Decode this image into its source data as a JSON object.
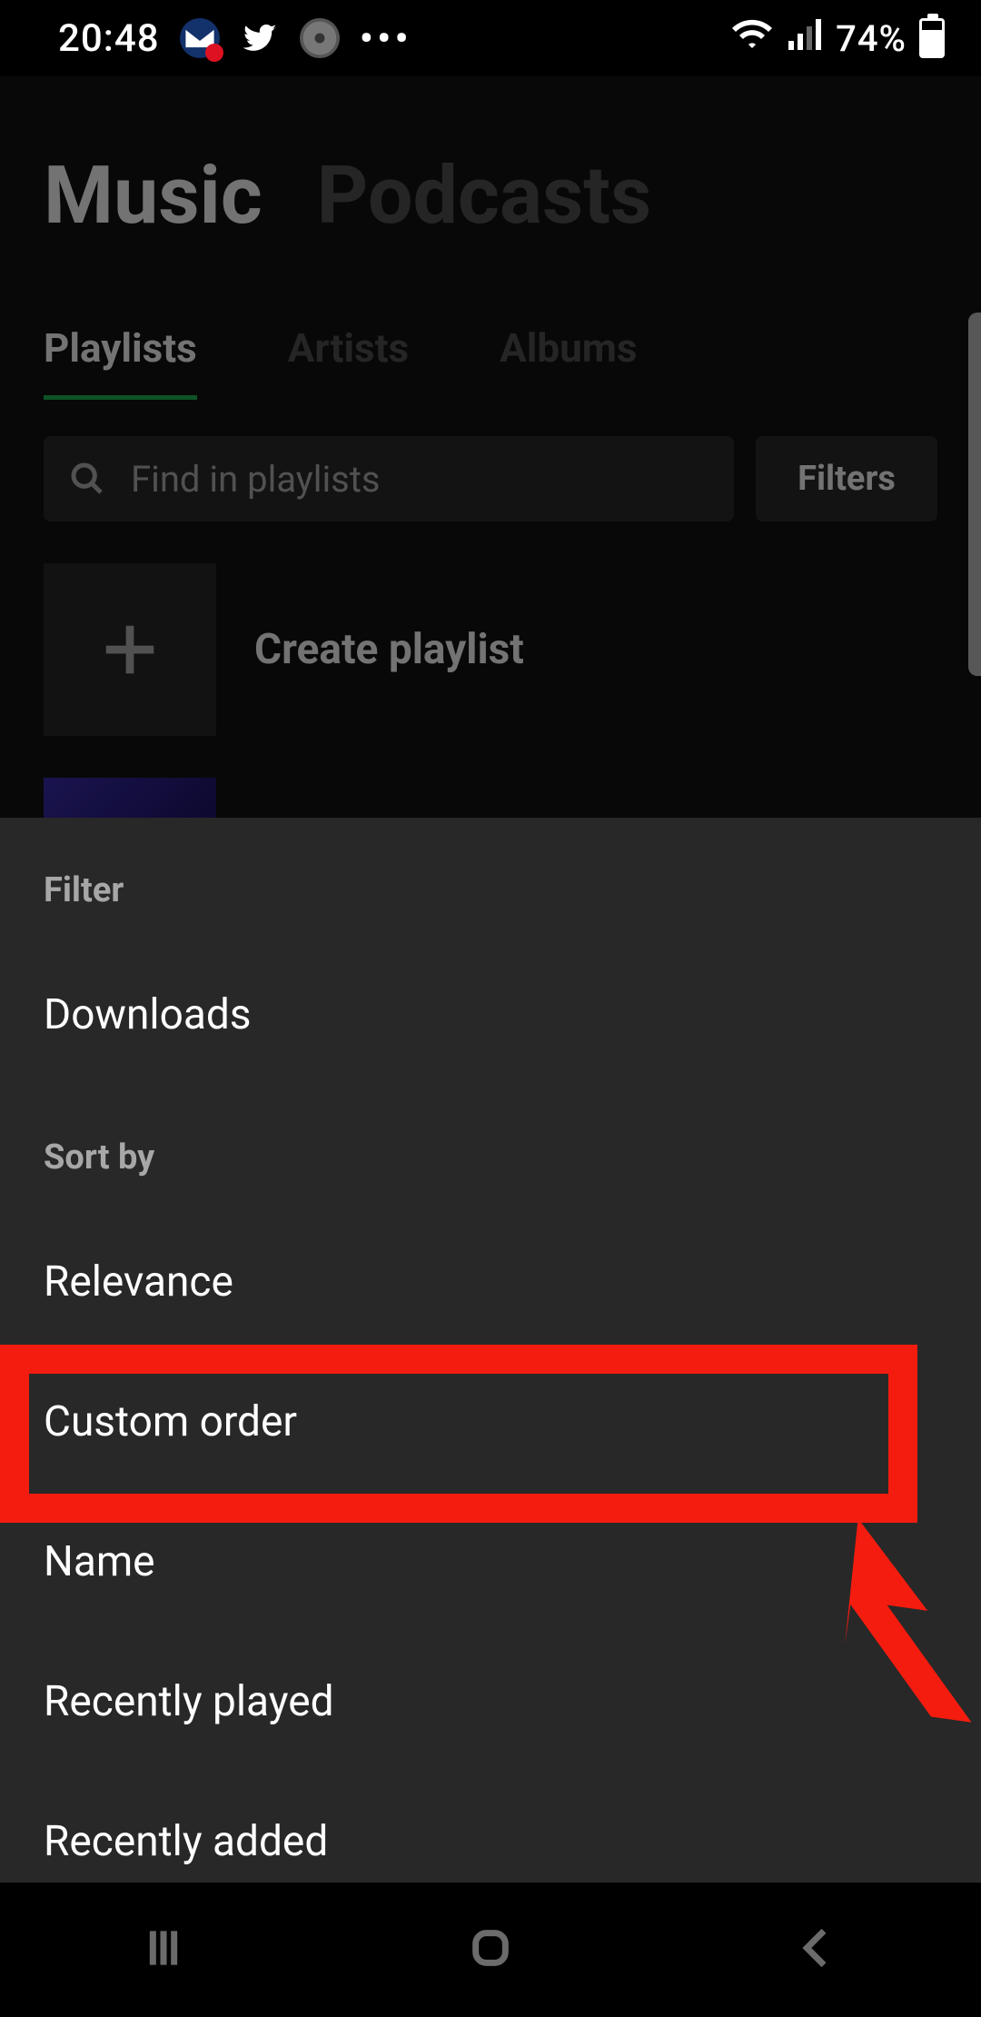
{
  "status": {
    "time": "20:48",
    "battery": "74%"
  },
  "header": {
    "tabs": [
      "Music",
      "Podcasts"
    ],
    "active": 0
  },
  "subtabs": {
    "items": [
      "Playlists",
      "Artists",
      "Albums"
    ],
    "active": 0
  },
  "search": {
    "placeholder": "Find in playlists",
    "filters_label": "Filters"
  },
  "create": {
    "label": "Create playlist"
  },
  "sheet": {
    "filter_title": "Filter",
    "filter_items": [
      "Downloads"
    ],
    "sort_title": "Sort by",
    "sort_items": [
      "Relevance",
      "Custom order",
      "Name",
      "Recently played",
      "Recently added"
    ],
    "highlighted_index": 1
  },
  "annotation": {
    "color": "#f41c0f"
  }
}
